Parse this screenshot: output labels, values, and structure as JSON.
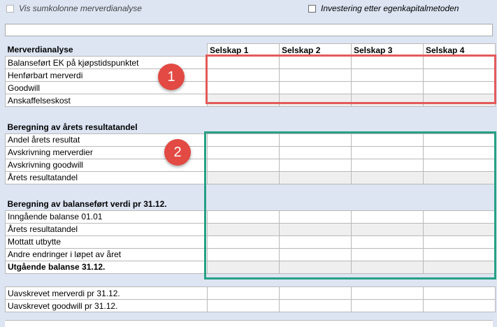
{
  "options": {
    "sum_column_label": "Vis sumkolonne merverdianalyse",
    "equity_method_label": "Investering etter egenkapitalmetoden"
  },
  "search": {
    "value": ""
  },
  "companies": [
    "Selskap 1",
    "Selskap 2",
    "Selskap 3",
    "Selskap 4"
  ],
  "merverdi": {
    "title": "Merverdianalyse",
    "rows": [
      "Balanseført EK på kjøpstidspunktet",
      "Henførbart merverdi",
      "Goodwill",
      "Anskaffelseskost"
    ]
  },
  "resultat": {
    "title": "Beregning av årets resultatandel",
    "rows": [
      "Andel årets resultat",
      "Avskrivning merverdier",
      "Avskrivning goodwill",
      "Årets resultatandel"
    ]
  },
  "balanse": {
    "title": "Beregning av balanseført verdi pr 31.12.",
    "rows": [
      "Inngående balanse 01.01",
      "Årets resultatandel",
      "Mottatt utbytte",
      "Andre endringer i løpet av året",
      "Utgående balanse 31.12."
    ]
  },
  "uavskrevet": {
    "rows": [
      "Uavskrevet merverdi pr 31.12.",
      "Uavskrevet goodwill pr 31.12."
    ]
  },
  "annotations": {
    "badge1": "1",
    "badge2": "2",
    "red": "#e35a5a",
    "green": "#26a084"
  }
}
